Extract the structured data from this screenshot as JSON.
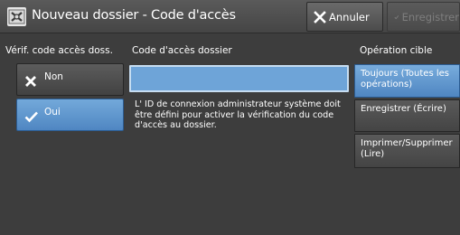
{
  "header": {
    "title": "Nouveau dossier - Code d'accès",
    "cancel_label": "Annuler",
    "save_label": "Enregistrer"
  },
  "columns": {
    "verif_heading": "Vérif. code accès doss.",
    "code_heading": "Code d'accès dossier",
    "operation_heading": "Opération cible"
  },
  "verif_options": [
    {
      "label": "Non",
      "selected": false
    },
    {
      "label": "Oui",
      "selected": true
    }
  ],
  "code_field": {
    "value": ""
  },
  "info_text": "L' ID de connexion administrateur système doit être défini pour activer la vérification du code d'accès au dossier.",
  "operations": [
    {
      "label": "Toujours (Toutes les opérations)",
      "selected": true
    },
    {
      "label": "Enregistrer (Écrire)",
      "selected": false
    },
    {
      "label": "Imprimer/Supprimer (Lire)",
      "selected": false
    }
  ],
  "colors": {
    "background": "#3d3d3d",
    "selected_blue": "#5f95ce",
    "disabled_text": "#7e7e7e"
  }
}
